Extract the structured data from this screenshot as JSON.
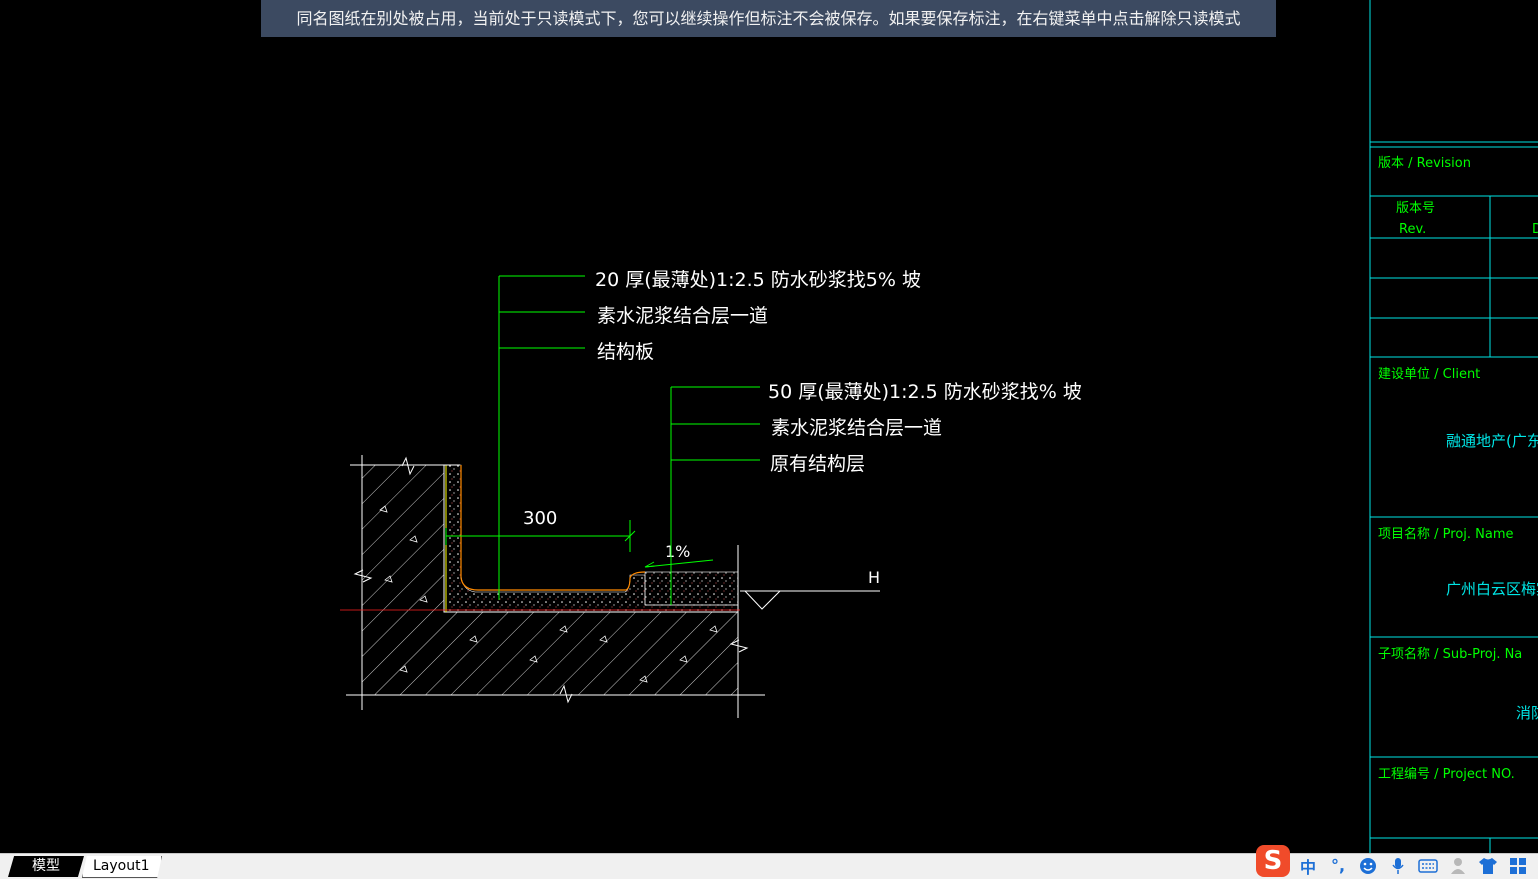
{
  "banner": {
    "message": "同名图纸在别处被占用，当前处于只读模式下，您可以继续操作但标注不会被保存。如果要保存标注，在右键菜单中点击解除只读模式"
  },
  "drawing": {
    "upper_callout": [
      "20 厚(最薄处)1:2.5 防水砂浆找5% 坡",
      "素水泥浆结合层一道",
      "结构板"
    ],
    "lower_callout": [
      "50 厚(最薄处)1:2.5 防水砂浆找% 坡",
      "素水泥浆结合层一道",
      "原有结构层"
    ],
    "dimension": "300",
    "slope": "1%",
    "level_mark": "H"
  },
  "title_block": {
    "revision": "版本 /  Revision",
    "rev_no_cn": "版本号",
    "rev_no_en": "Rev.",
    "rev_col2": "D",
    "client_label": "建设单位 /  Client",
    "client_value": "融通地产(广东)有限",
    "proj_label": "项目名称 /  Proj. Name",
    "proj_value": "广州白云区梅宾北路",
    "subproj_label": "子项名称 /  Sub-Proj. Na",
    "subproj_value": "消防",
    "projno_label": "工程编号 /  Project NO."
  },
  "tabs": {
    "model": "模型",
    "layout1": "Layout1"
  },
  "ime": {
    "logo": "S",
    "lang": "中",
    "punct": "°,"
  },
  "colors": {
    "green": "#00ff00",
    "cyan": "#00e5e5",
    "white": "#ffffff",
    "red": "#ff2020",
    "banner_bg": "#3c4a61"
  }
}
